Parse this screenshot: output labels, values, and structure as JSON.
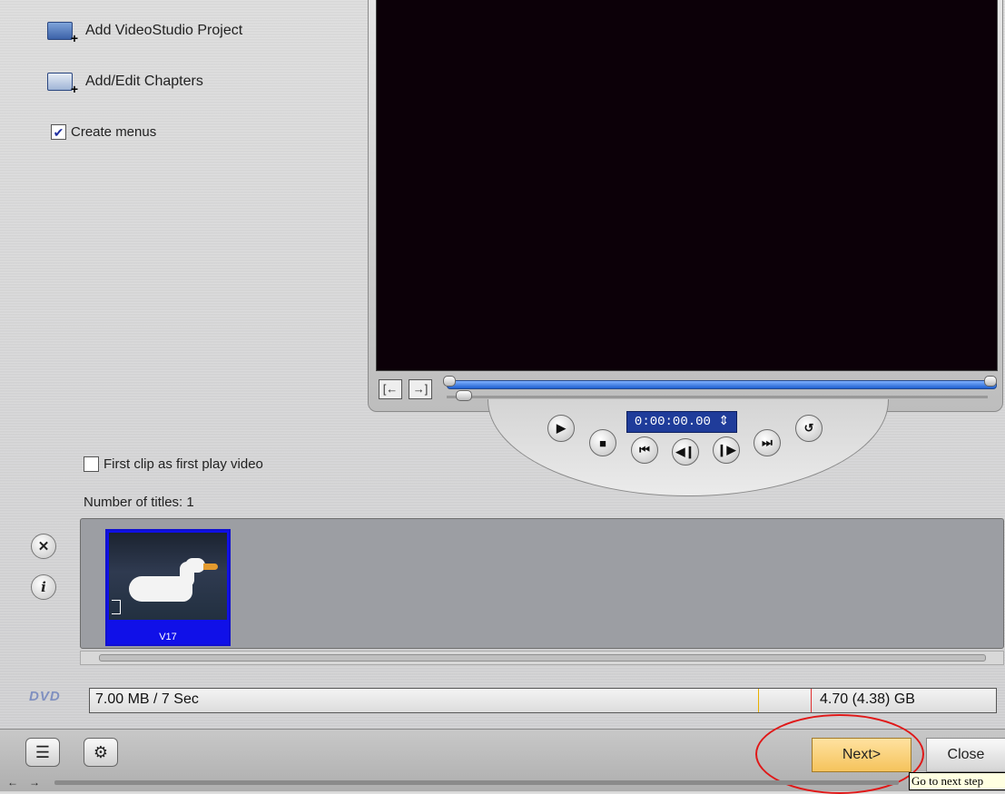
{
  "options": {
    "add_project": "Add VideoStudio Project",
    "add_chapters": "Add/Edit Chapters",
    "create_menus": "Create menus",
    "create_menus_checked": true
  },
  "player": {
    "timecode": "0:00:00.00"
  },
  "titles": {
    "first_clip_label": "First clip as first play video",
    "first_clip_checked": false,
    "count_label": "Number of titles: 1",
    "items": [
      {
        "label": "V17"
      }
    ]
  },
  "capacity": {
    "disc_label": "DVD",
    "used": "7.00 MB / 7 Sec",
    "total": "4.70 (4.38) GB"
  },
  "footer": {
    "next_label": "Next>",
    "close_label": "Close",
    "tooltip": "Go to next step"
  },
  "colors": {
    "accent_blue": "#1f3c9a",
    "next_button": "#f5c35c",
    "highlight_circle": "#e01818"
  }
}
